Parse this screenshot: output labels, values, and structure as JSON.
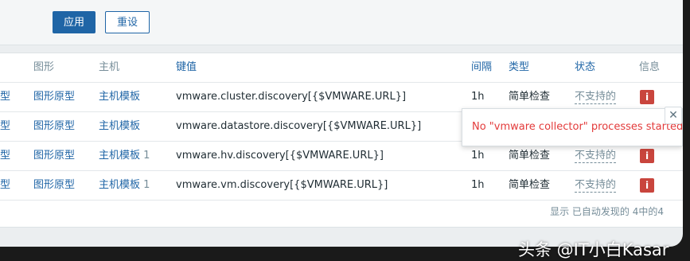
{
  "toolbar": {
    "apply_label": "应用",
    "reset_label": "重设"
  },
  "table": {
    "headers": {
      "graph": "图形",
      "host": "主机",
      "key": "键值",
      "interval": "间隔",
      "type": "类型",
      "status": "状态",
      "info": "信息"
    },
    "rows": [
      {
        "graph": "图形原型",
        "host": "主机模板",
        "host_count": "",
        "key": "vmware.cluster.discovery[{$VMWARE.URL}]",
        "interval": "1h",
        "type": "简单检查",
        "status": "不支持的"
      },
      {
        "graph": "图形原型",
        "host": "主机模板",
        "host_count": "",
        "key": "vmware.datastore.discovery[{$VMWARE.URL}]",
        "interval": "",
        "type": "",
        "status": ""
      },
      {
        "graph": "图形原型",
        "host": "主机模板",
        "host_count": "1",
        "key": "vmware.hv.discovery[{$VMWARE.URL}]",
        "interval": "1h",
        "type": "简单检查",
        "status": "不支持的"
      },
      {
        "graph": "图形原型",
        "host": "主机模板",
        "host_count": "1",
        "key": "vmware.vm.discovery[{$VMWARE.URL}]",
        "interval": "1h",
        "type": "简单检查",
        "status": "不支持的"
      }
    ],
    "footer": "显示 已自动发现的 4中的4"
  },
  "error_popup": {
    "message": "No \"vmware collector\" processes started."
  },
  "watermark": "头条 @IT小白Kasar",
  "icons": {
    "info": "info-icon",
    "close": "close-icon"
  },
  "colors": {
    "link": "#1f65a6",
    "error": "#e33b3b",
    "info_icon": "#c9453d"
  }
}
